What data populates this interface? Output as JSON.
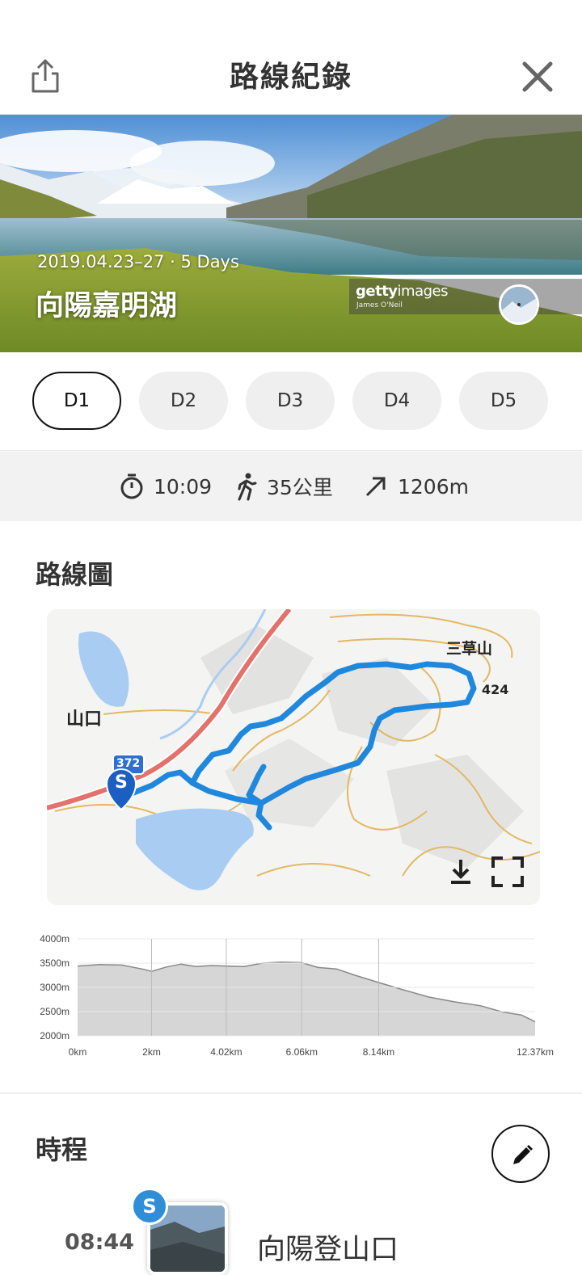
{
  "header": {
    "title": "路線紀錄",
    "share_icon": "share-icon",
    "close_icon": "close-icon"
  },
  "hero": {
    "date_range": "2019.04.23–27 · 5 Days",
    "trail_name": "向陽嘉明湖",
    "credit_brand_bold": "getty",
    "credit_brand_light": "images",
    "credit_author": "James O'Neil"
  },
  "days": [
    "D1",
    "D2",
    "D3",
    "D4",
    "D5"
  ],
  "selected_day": "D1",
  "stats": {
    "duration": "10:09",
    "distance": "35公里",
    "ascent": "1206m"
  },
  "route_map": {
    "title": "路線圖",
    "labels": {
      "trailhead_area": "山口",
      "peak_name": "三草山",
      "peak_elevation": "424",
      "road_number": "372",
      "start_marker": "S"
    },
    "download_icon": "download-icon",
    "fullscreen_icon": "fullscreen-icon",
    "colors": {
      "route": "#1f88dc",
      "road": "#e2726a",
      "contour": "#e3b865",
      "water": "#a9cdf2"
    }
  },
  "chart_data": {
    "type": "area",
    "title": "",
    "xlabel": "",
    "ylabel": "",
    "x_ticks_km": [
      "0km",
      "2km",
      "4.02km",
      "6.06km",
      "8.14km",
      "12.37km"
    ],
    "y_ticks": [
      "4000m",
      "3500m",
      "3000m",
      "2500m",
      "2000m"
    ],
    "ylim": [
      2000,
      4000
    ],
    "xlim": [
      0,
      12.37
    ],
    "grid": true,
    "x": [
      0,
      0.6,
      1.2,
      1.8,
      2.0,
      2.4,
      2.8,
      3.2,
      3.6,
      4.02,
      4.5,
      5.0,
      5.5,
      6.06,
      6.5,
      7.0,
      7.5,
      8.14,
      8.8,
      9.5,
      10.2,
      10.9,
      11.5,
      12.0,
      12.37
    ],
    "y": [
      3440,
      3470,
      3460,
      3370,
      3330,
      3420,
      3480,
      3430,
      3450,
      3440,
      3430,
      3500,
      3520,
      3510,
      3410,
      3380,
      3250,
      3100,
      2950,
      2800,
      2700,
      2620,
      2490,
      2430,
      2290
    ],
    "color": "#d6d6d6"
  },
  "schedule": {
    "title": "時程",
    "edit_icon": "edit-icon",
    "first_entry": {
      "time": "08:44",
      "badge": "S",
      "place": "向陽登山口"
    }
  }
}
